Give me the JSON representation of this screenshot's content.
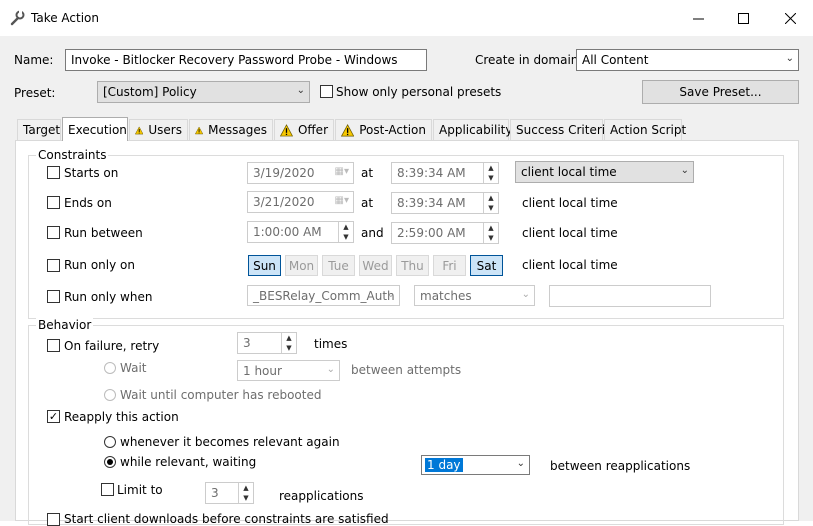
{
  "window": {
    "title": "Take Action",
    "icon": "wrench-icon",
    "controls": [
      "minimize",
      "maximize",
      "close"
    ]
  },
  "header": {
    "name_label": "Name:",
    "name_value": "Invoke - Bitlocker Recovery Password Probe - Windows",
    "create_in_domain_label": "Create in domain:",
    "domain_value": "All Content",
    "preset_label": "Preset:",
    "preset_value": "[Custom] Policy",
    "personal_presets_label": "Show only personal presets",
    "save_preset_label": "Save Preset..."
  },
  "tabs": [
    {
      "label": "Target",
      "warning": false
    },
    {
      "label": "Execution",
      "warning": false,
      "active": true
    },
    {
      "label": "Users",
      "warning": true
    },
    {
      "label": "Messages",
      "warning": true
    },
    {
      "label": "Offer",
      "warning": true
    },
    {
      "label": "Post-Action",
      "warning": true
    },
    {
      "label": "Applicability",
      "warning": false
    },
    {
      "label": "Success Criteria",
      "warning": false
    },
    {
      "label": "Action Script",
      "warning": false
    }
  ],
  "constraints": {
    "group_label": "Constraints",
    "starts_on": {
      "label": "Starts on",
      "date": "3/19/2020",
      "at": "at",
      "time": "8:39:34 AM",
      "timezone": "client local time"
    },
    "ends_on": {
      "label": "Ends on",
      "date": "3/21/2020",
      "at": "at",
      "time": "8:39:34 AM",
      "timezone": "client local time"
    },
    "run_between": {
      "label": "Run between",
      "from": "1:00:00 AM",
      "and": "and",
      "to": "2:59:00 AM",
      "timezone": "client local time"
    },
    "run_only_on": {
      "label": "Run only on",
      "days": [
        {
          "label": "Sun",
          "selected": true
        },
        {
          "label": "Mon",
          "selected": false
        },
        {
          "label": "Tue",
          "selected": false
        },
        {
          "label": "Wed",
          "selected": false
        },
        {
          "label": "Thu",
          "selected": false
        },
        {
          "label": "Fri",
          "selected": false
        },
        {
          "label": "Sat",
          "selected": true
        }
      ],
      "timezone": "client local time"
    },
    "run_only_when": {
      "label": "Run only when",
      "property": "_BESRelay_Comm_Auth",
      "operator": "matches",
      "value": ""
    }
  },
  "behavior": {
    "group_label": "Behavior",
    "on_failure": {
      "label": "On failure, retry",
      "count": "3",
      "times": "times"
    },
    "wait": {
      "label": "Wait",
      "interval": "1 hour",
      "between": "between attempts"
    },
    "wait_reboot": {
      "label": "Wait until computer has rebooted"
    },
    "reapply": {
      "label": "Reapply this action",
      "checked": true
    },
    "whenever": {
      "label": "whenever it becomes relevant again"
    },
    "while_relevant": {
      "label": "while relevant, waiting",
      "interval": "1 day",
      "between": "between reapplications"
    },
    "limit_to": {
      "label": "Limit to",
      "count": "3",
      "reapplications": "reapplications"
    },
    "start_downloads": {
      "label": "Start client downloads before constraints are satisfied"
    }
  },
  "colors": {
    "warning": "#f6c700",
    "selection": "#0078d7",
    "day_selected": "#cce4f7"
  }
}
